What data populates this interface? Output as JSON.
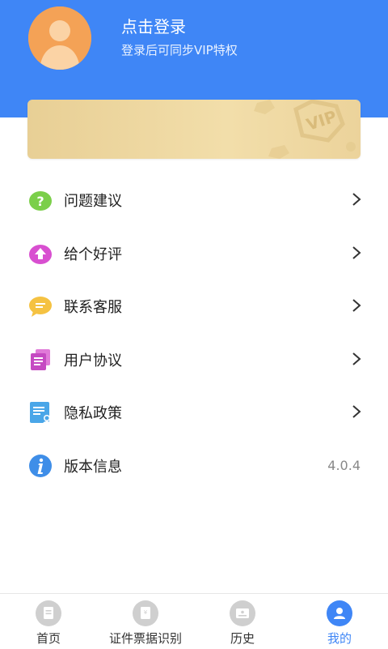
{
  "profile": {
    "title": "点击登录",
    "subtitle": "登录后可同步VIP特权",
    "avatar_icon": "user-avatar-icon"
  },
  "vip_banner": {
    "badge_text": "VIP",
    "colors": {
      "start": "#e8cf95",
      "end": "#ecd39b"
    }
  },
  "menu": {
    "items": [
      {
        "label": "问题建议",
        "icon": "question-icon",
        "color": "#7bcf4a"
      },
      {
        "label": "给个好评",
        "icon": "rate-up-icon",
        "color": "#d84fd0"
      },
      {
        "label": "联系客服",
        "icon": "chat-icon",
        "color": "#f5c242"
      },
      {
        "label": "用户协议",
        "icon": "document-stack-icon",
        "color": "#c54ac2"
      },
      {
        "label": "隐私政策",
        "icon": "privacy-doc-icon",
        "color": "#4aa6e8"
      },
      {
        "label": "版本信息",
        "icon": "info-icon",
        "color": "#3f8ee8",
        "value": "4.0.4"
      }
    ]
  },
  "tabbar": {
    "tabs": [
      {
        "label": "首页",
        "icon": "home-doc-icon",
        "active": false
      },
      {
        "label": "证件票据识别",
        "icon": "scan-id-icon",
        "active": false
      },
      {
        "label": "历史",
        "icon": "history-card-icon",
        "active": false
      },
      {
        "label": "我的",
        "icon": "profile-icon",
        "active": true
      }
    ]
  },
  "theme": {
    "accent": "#3f86f6",
    "header_bg": "#3f86f6"
  }
}
